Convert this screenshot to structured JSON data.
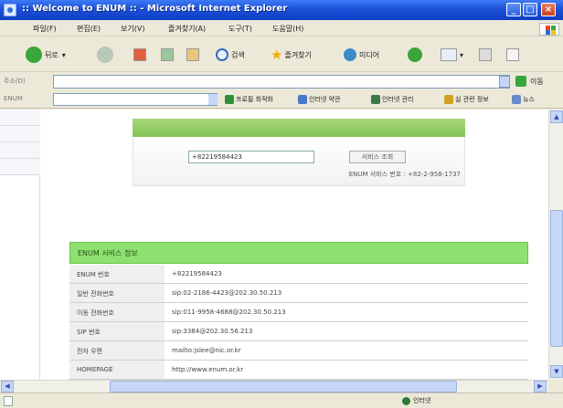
{
  "window": {
    "title": ":: Welcome to ENUM :: - Microsoft Internet Explorer",
    "min_glyph": "_",
    "max_glyph": "□",
    "close_glyph": "×"
  },
  "menu": [
    {
      "label": "파일(F)"
    },
    {
      "label": "편집(E)"
    },
    {
      "label": "보기(V)"
    },
    {
      "label": "즐겨찾기(A)"
    },
    {
      "label": "도구(T)"
    },
    {
      "label": "도움말(H)"
    }
  ],
  "toolbar": {
    "back_label": "뒤로",
    "search_label": "검색",
    "favorites_label": "즐겨찾기",
    "media_label": "미디어"
  },
  "address": {
    "label": "주소(D)",
    "value": "",
    "go_label": "이동"
  },
  "links": {
    "label": "ENUM",
    "items": [
      {
        "label": "프로필 최적화",
        "color": "#2f8f3a"
      },
      {
        "label": "인터넷 약관",
        "color": "#4a78c8"
      },
      {
        "label": "인터넷 관리",
        "color": "#3a7a4a"
      },
      {
        "label": "실 관련 정보",
        "color": "#d0a020"
      },
      {
        "label": "뉴스",
        "color": "#6a8ac8"
      }
    ]
  },
  "search": {
    "input_value": "+82219584423",
    "button_label": "서비스 조회",
    "service_number": "ENUM 서비스 번호 : +82-2-958-1737"
  },
  "info": {
    "header": "ENUM 서비스 정보",
    "rows": [
      {
        "key": "ENUM 번호",
        "value": "+82219584423"
      },
      {
        "key": "일반 전화번호",
        "value": "sip:02-2186-4423@202.30.50.213"
      },
      {
        "key": "이동 전화번호",
        "value": "sip:011-9958-4688@202.30.50.213"
      },
      {
        "key": "SIP 번호",
        "value": "sip:3384@202.30.56.213"
      },
      {
        "key": "전자 우편",
        "value": "mailto:jslee@nic.or.kr"
      },
      {
        "key": "HOMEPAGE",
        "value": "http://www.enum.or.kr"
      }
    ]
  },
  "status": {
    "zone": "인터넷"
  },
  "colors": {
    "titlebar": "#1c50d8",
    "header_band": "#82c558",
    "info_header": "#8ee070"
  }
}
